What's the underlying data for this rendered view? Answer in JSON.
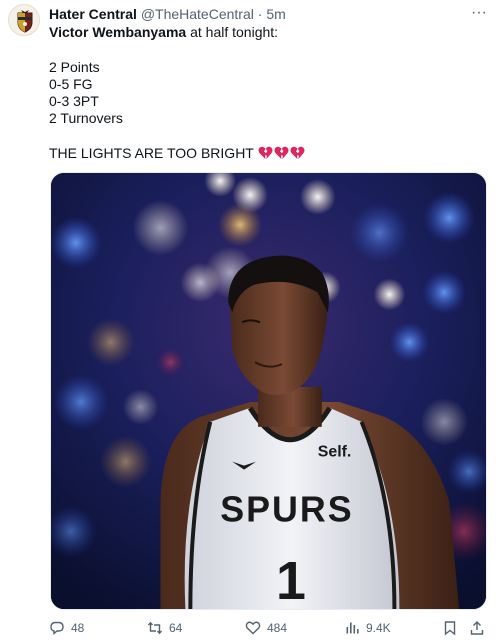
{
  "author": {
    "display_name": "Hater Central",
    "handle": "@TheHateCentral",
    "separator": "·",
    "time": "5m",
    "avatar_icon": "shield-crest-icon"
  },
  "menu": {
    "more_label": "···"
  },
  "tweet": {
    "player_name": "Victor Wembanyama",
    "intro_rest": " at half tonight:",
    "stats": [
      "2 Points",
      "0-5 FG",
      "0-3 3PT",
      "2 Turnovers"
    ],
    "closing": "THE LIGHTS ARE TOO BRIGHT",
    "closing_emoji": [
      "broken-heart-icon",
      "broken-heart-icon",
      "broken-heart-icon"
    ]
  },
  "media": {
    "jersey_sponsor": "Self.",
    "jersey_team": "SPURS",
    "jersey_number": "1"
  },
  "actions": {
    "replies": "48",
    "retweets": "64",
    "likes": "484",
    "views": "9.4K"
  },
  "colors": {
    "text": "#0f1419",
    "secondary": "#536471",
    "broken_heart": "#e0245e",
    "photo_bg": "#0b1440"
  }
}
